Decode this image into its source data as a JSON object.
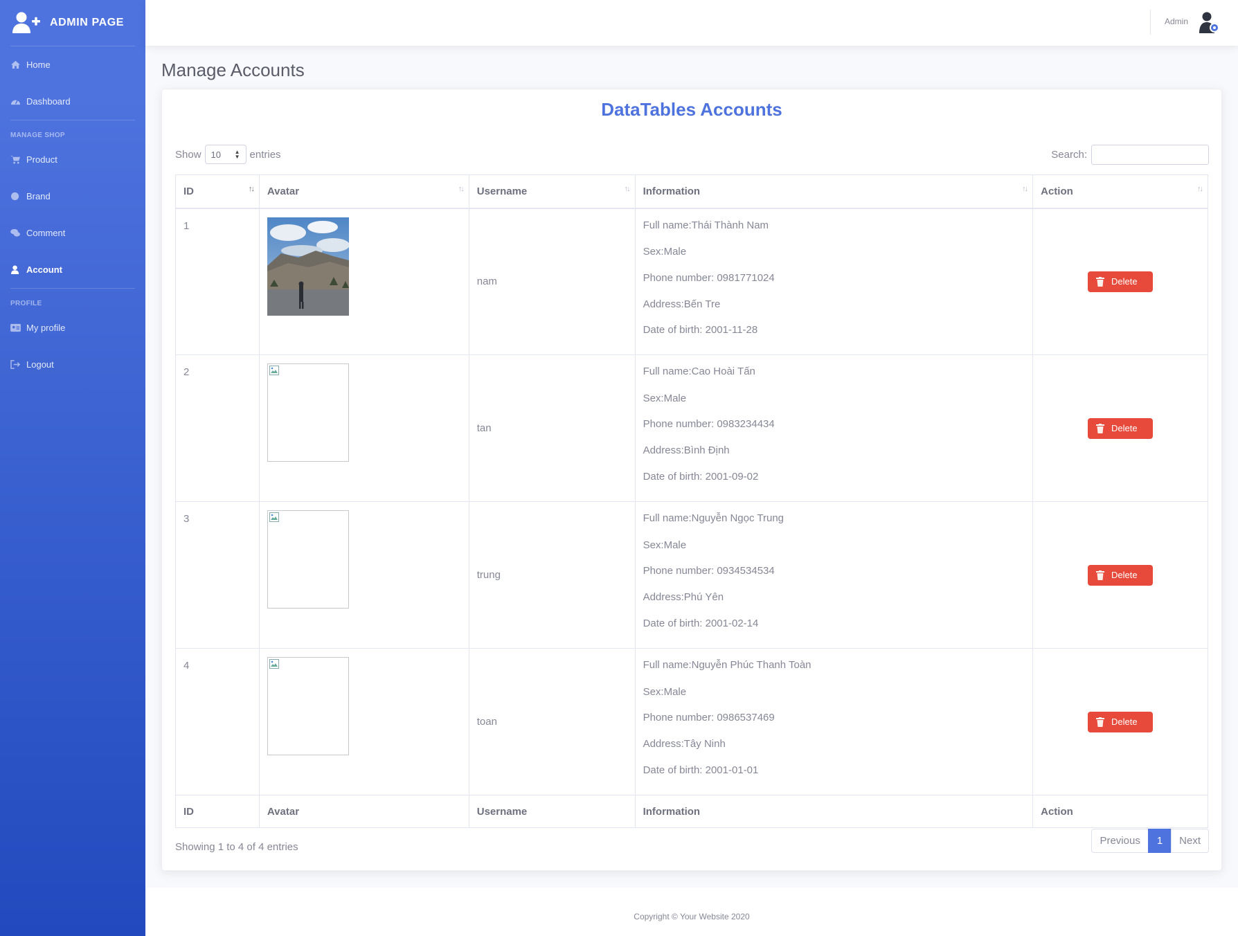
{
  "sidebar": {
    "brand": "ADMIN PAGE",
    "items": [
      {
        "label": "Home",
        "icon": "home-icon"
      },
      {
        "label": "Dashboard",
        "icon": "tachometer-icon"
      }
    ],
    "heading_shop": "MANAGE SHOP",
    "shop_items": [
      {
        "label": "Product",
        "icon": "cart-icon"
      },
      {
        "label": "Brand",
        "icon": "circle-icon"
      },
      {
        "label": "Comment",
        "icon": "comments-icon"
      },
      {
        "label": "Account",
        "icon": "user-icon",
        "active": true
      }
    ],
    "heading_profile": "PROFILE",
    "profile_items": [
      {
        "label": "My profile",
        "icon": "id-card-icon"
      },
      {
        "label": "Logout",
        "icon": "sign-out-icon"
      }
    ]
  },
  "topbar": {
    "user_name": "Admin"
  },
  "page": {
    "title": "Manage Accounts",
    "card_title": "DataTables Accounts"
  },
  "table_controls": {
    "show_label": "Show",
    "page_length": "10",
    "entries_label": "entries",
    "search_label": "Search:",
    "search_value": ""
  },
  "table": {
    "columns": [
      "ID",
      "Avatar",
      "Username",
      "Information",
      "Action"
    ],
    "rows": [
      {
        "id": "1",
        "username": "nam",
        "info": [
          "Full name:Thái Thành Nam",
          "Sex:Male",
          "Phone number: 0981771024",
          "Address:Bến Tre",
          "Date of birth: 2001-11-28"
        ],
        "action": "Delete"
      },
      {
        "id": "2",
        "username": "tan",
        "info": [
          "Full name:Cao Hoài Tấn",
          "Sex:Male",
          "Phone number: 0983234434",
          "Address:Bình Định",
          "Date of birth: 2001-09-02"
        ],
        "action": "Delete"
      },
      {
        "id": "3",
        "username": "trung",
        "info": [
          "Full name:Nguyễn Ngọc Trung",
          "Sex:Male",
          "Phone number: 0934534534",
          "Address:Phú Yên",
          "Date of birth: 2001-02-14"
        ],
        "action": "Delete"
      },
      {
        "id": "4",
        "username": "toan",
        "info": [
          "Full name:Nguyễn Phúc Thanh Toàn",
          "Sex:Male",
          "Phone number: 0986537469",
          "Address:Tây Ninh",
          "Date of birth: 2001-01-01"
        ],
        "action": "Delete"
      }
    ]
  },
  "pagination": {
    "info": "Showing 1 to 4 of 4 entries",
    "previous": "Previous",
    "current_page": "1",
    "next": "Next"
  },
  "footer": {
    "copyright": "Copyright © Your Website 2020"
  },
  "colors": {
    "primary": "#4e73df",
    "primary_dark": "#224abe",
    "danger": "#e74a3b",
    "text": "#858796"
  }
}
